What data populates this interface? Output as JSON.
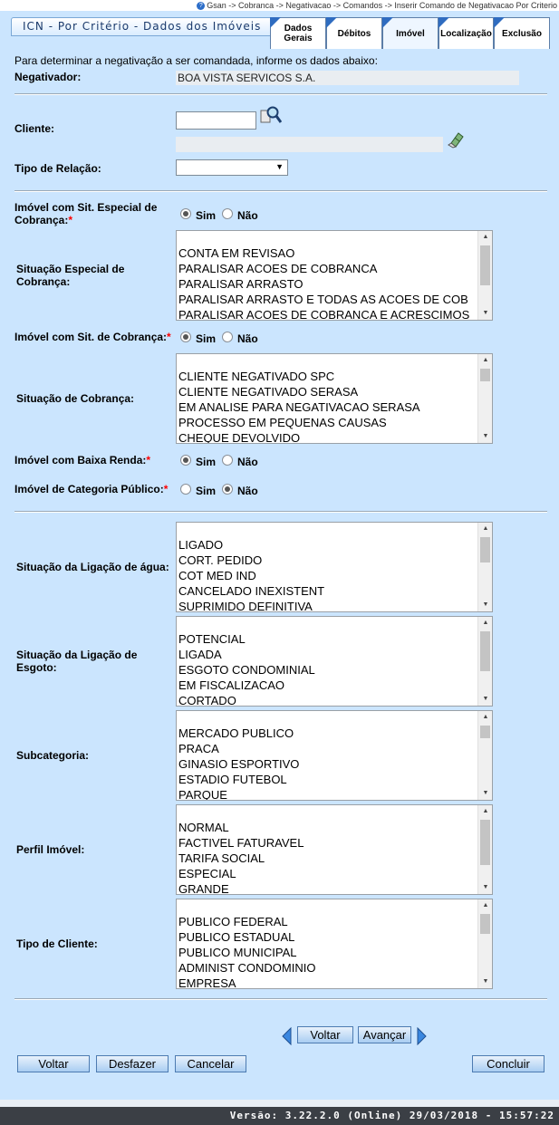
{
  "breadcrumb": "Gsan -> Cobranca -> Negativacao -> Comandos -> Inserir Comando de Negativacao Por Criterio",
  "title": "ICN - Por Critério - Dados dos Imóveis",
  "tabs": [
    {
      "label": "Dados Gerais"
    },
    {
      "label": "Débitos"
    },
    {
      "label": "Imóvel"
    },
    {
      "label": "Localização"
    },
    {
      "label": "Exclusão"
    }
  ],
  "intro": "Para determinar a negativação a ser comandada, informe os dados abaixo:",
  "negativador": {
    "label": "Negativador:",
    "value": "BOA VISTA SERVICOS S.A."
  },
  "cliente": {
    "label": "Cliente:",
    "code": "",
    "name": ""
  },
  "tipo_relacao": {
    "label": "Tipo de Relação:",
    "selected": ""
  },
  "radio_options": {
    "sim": "Sim",
    "nao": "Não"
  },
  "sit_especial": {
    "label_line1": "Imóvel com Sit. Especial de",
    "label_line2": "Cobrança:",
    "value": "Sim"
  },
  "situacao_especial": {
    "label_line1": "Situação Especial de",
    "label_line2": "Cobrança:",
    "items": [
      "CONTA EM REVISAO",
      "PARALISAR ACOES DE COBRANCA",
      "PARALISAR ARRASTO",
      "PARALISAR ARRASTO E TODAS AS ACOES DE COB",
      "PARALISAR ACOES DE COBRANCA E ACRESCIMOS"
    ]
  },
  "sit_cobranca": {
    "label": "Imóvel com Sit. de Cobrança:",
    "value": "Sim"
  },
  "situacao_cobranca": {
    "label": "Situação de Cobrança:",
    "items": [
      "CLIENTE NEGATIVADO SPC",
      "CLIENTE NEGATIVADO SERASA",
      "EM ANALISE PARA NEGATIVACAO SERASA",
      "PROCESSO EM PEQUENAS CAUSAS",
      "CHEQUE DEVOLVIDO"
    ]
  },
  "baixa_renda": {
    "label": "Imóvel com Baixa Renda:",
    "value": "Sim"
  },
  "categoria_publico": {
    "label": "Imóvel de Categoria Público:",
    "value": "Não"
  },
  "ligacao_agua": {
    "label": "Situação da Ligação de água:",
    "items": [
      "LIGADO",
      "CORT. PEDIDO",
      "COT MED IND",
      "CANCELADO INEXISTENT",
      "SUPRIMIDO DEFINITIVA"
    ]
  },
  "ligacao_esgoto": {
    "label_line1": "Situação da Ligação de",
    "label_line2": "Esgoto:",
    "items": [
      "POTENCIAL",
      "LIGADA",
      "ESGOTO CONDOMINIAL",
      "EM FISCALIZACAO",
      "CORTADO"
    ]
  },
  "subcategoria": {
    "label": "Subcategoria:",
    "items": [
      "MERCADO PUBLICO",
      "PRACA",
      "GINASIO ESPORTIVO",
      "ESTADIO FUTEBOL",
      "PARQUE"
    ]
  },
  "perfil_imovel": {
    "label": "Perfil Imóvel:",
    "items": [
      "NORMAL",
      "FACTIVEL FATURAVEL",
      "TARIFA SOCIAL",
      "ESPECIAL",
      "GRANDE"
    ]
  },
  "tipo_cliente": {
    "label": "Tipo de Cliente:",
    "items": [
      "PUBLICO FEDERAL",
      "PUBLICO ESTADUAL",
      "PUBLICO MUNICIPAL",
      "ADMINIST CONDOMINIO",
      "EMPRESA"
    ]
  },
  "nav": {
    "voltar": "Voltar",
    "avancar": "Avançar"
  },
  "actions": {
    "voltar": "Voltar",
    "desfazer": "Desfazer",
    "cancelar": "Cancelar",
    "concluir": "Concluir"
  },
  "footer": "Versão: 3.22.2.0 (Online) 29/03/2018 - 15:57:22",
  "colors": {
    "background": "#cbe5fe",
    "tab_corner": "#2f6cc0",
    "footer": "#3b3f45",
    "required": "#ff0000"
  }
}
